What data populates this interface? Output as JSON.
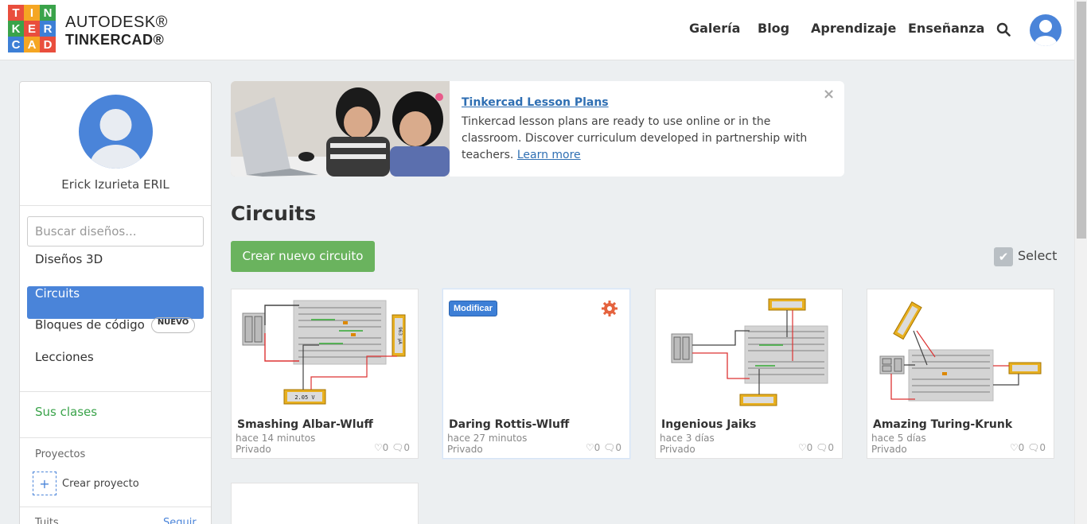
{
  "header": {
    "logo_letters": [
      "T",
      "I",
      "N",
      "K",
      "E",
      "R",
      "C",
      "A",
      "D"
    ],
    "logo_colors": [
      "#e94e3d",
      "#f5a623",
      "#3aa34a",
      "#3aa34a",
      "#e94e3d",
      "#3d7fd6",
      "#3d7fd6",
      "#f5a623",
      "#e94e3d"
    ],
    "brand_line1": "AUTODESK®",
    "brand_line2": "TINKERCAD®",
    "nav": [
      "Galería",
      "Blog",
      "Aprendizaje",
      "Enseñanza"
    ]
  },
  "sidebar": {
    "user_name": "Erick Izurieta ERIL",
    "search_placeholder": "Buscar diseños...",
    "items": [
      {
        "label": "Diseños 3D"
      },
      {
        "label": "Circuits"
      },
      {
        "label": "Bloques de código",
        "badge": "NUEVO"
      },
      {
        "label": "Lecciones"
      }
    ],
    "classes_link": "Sus clases",
    "projects_title": "Proyectos",
    "create_project": "Crear proyecto",
    "tuits": "Tuits",
    "follow": "Seguir"
  },
  "banner": {
    "title": "Tinkercad Lesson Plans",
    "text": "Tinkercad lesson plans are ready to use online or in the classroom. Discover curriculum developed in partnership with teachers.",
    "link": "Learn more",
    "close": "×"
  },
  "main": {
    "title": "Circuits",
    "create_button": "Crear nuevo circuito",
    "select_label": "Select",
    "select_check": "✔"
  },
  "cards": [
    {
      "title": "Smashing Albar-Wluff",
      "time": "hace 14 minutos",
      "privacy": "Privado",
      "likes": "0",
      "comments": "0"
    },
    {
      "title": "Daring Rottis-Wluff",
      "time": "hace 27 minutos",
      "privacy": "Privado",
      "likes": "0",
      "comments": "0",
      "modify_label": "Modificar"
    },
    {
      "title": "Ingenious Jaiks",
      "time": "hace 3 días",
      "privacy": "Privado",
      "likes": "0",
      "comments": "0"
    },
    {
      "title": "Amazing Turing-Krunk",
      "time": "hace 5 días",
      "privacy": "Privado",
      "likes": "0",
      "comments": "0"
    }
  ],
  "thumb_labels": {
    "card1_display_a": "963 µA",
    "card1_display_b": "2.05 V"
  }
}
